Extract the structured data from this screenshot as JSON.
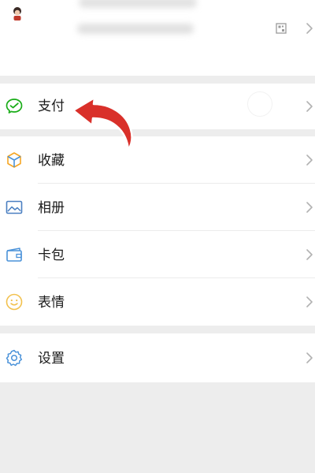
{
  "menu": {
    "pay": "支付",
    "favorites": "收藏",
    "album": "相册",
    "cards": "卡包",
    "stickers": "表情",
    "settings": "设置"
  },
  "icons": {
    "profile_chevron": "chevron-right-icon",
    "qr": "qr-code-icon",
    "pay": "wechat-pay-icon",
    "favorites": "favorites-cube-icon",
    "album": "album-picture-icon",
    "cards": "card-wallet-icon",
    "stickers": "sticker-smile-icon",
    "settings": "settings-gear-icon"
  },
  "colors": {
    "pay_green": "#1aad19",
    "favorites_orange": "#f6a623",
    "album_blue": "#4a7fc1",
    "cards_blue": "#4a92d9",
    "stickers_yellow": "#f2c14e",
    "settings_blue": "#4a92d9",
    "annotation_red": "#d9302a"
  }
}
